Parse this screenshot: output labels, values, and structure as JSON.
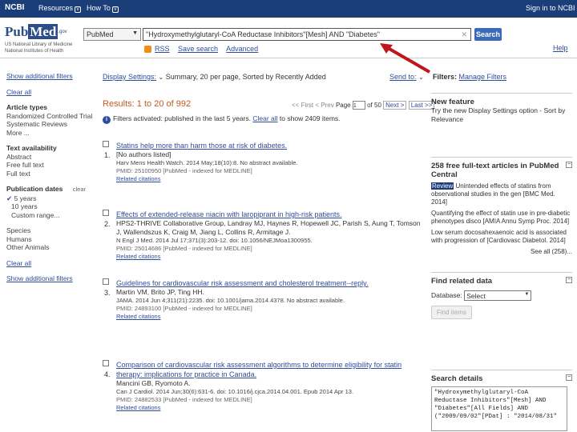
{
  "topbar": {
    "logo": "NCBI",
    "resources": "Resources",
    "howto": "How To",
    "signin": "Sign in to NCBI"
  },
  "header": {
    "logo_pub": "Pub",
    "logo_med": "Med",
    "logo_gov": ".gov",
    "nlm_line1": "US National Library of Medicine",
    "nlm_line2": "National Institutes of Health",
    "db_value": "PubMed",
    "search_value": "\"Hydroxymethylglutaryl-CoA Reductase Inhibitors\"[Mesh] AND \"Diabetes\"",
    "search_button": "Search",
    "rss": "RSS",
    "save_search": "Save search",
    "advanced": "Advanced",
    "help": "Help"
  },
  "left": {
    "show_filters": "Show additional filters",
    "clear_all": "Clear all",
    "article_types": "Article types",
    "at_items": [
      "Randomized Controlled Trial",
      "Systematic Reviews",
      "More ..."
    ],
    "text_avail": "Text availability",
    "ta_items": [
      "Abstract",
      "Free full text",
      "Full text"
    ],
    "pub_dates": "Publication dates",
    "clear": "clear",
    "pd_items": [
      "5 years",
      "10 years",
      "Custom range..."
    ],
    "species": "Species",
    "sp_items": [
      "Humans",
      "Other Animals"
    ],
    "clear_all2": "Clear all",
    "show_filters2": "Show additional filters"
  },
  "main": {
    "display_settings": "Display Settings:",
    "display_value": "Summary, 20 per page, Sorted by Recently Added",
    "send_to": "Send to:",
    "results": "Results: 1 to 20 of 992",
    "pager_first": "<< First",
    "pager_prev": "< Prev",
    "page_label": "Page",
    "page_value": "1",
    "page_of": "of 50",
    "pager_next": "Next >",
    "pager_last": "Last >>",
    "filter_notice": "Filters activated: published in the last 5 years.",
    "filter_clear": "Clear all",
    "filter_show": "to show 2409 items.",
    "results_list": [
      {
        "num": "1.",
        "title": "Statins help more than harm those at risk of diabetes.",
        "authors": "[No authors listed]",
        "cite": "Harv Mens Health Watch. 2014 May;18(10):8. No abstract available.",
        "pmid": "PMID: 25100950 [PubMed - indexed for MEDLINE]",
        "related": "Related citations"
      },
      {
        "num": "2.",
        "title": "Effects of extended-release niacin with laropiprant in high-risk patients.",
        "authors": "HPS2-THRIVE Collaborative Group, Landray MJ, Haynes R, Hopewell JC, Parish S, Aung T, Tomson J, Wallendszus K, Craig M, Jiang L, Collins R, Armitage J.",
        "cite": "N Engl J Med. 2014 Jul 17;371(3):203-12. doi: 10.1056/NEJMoa1300955.",
        "pmid": "PMID: 25014686 [PubMed - indexed for MEDLINE]",
        "related": "Related citations"
      },
      {
        "num": "3.",
        "title": "Guidelines for cardiovascular risk assessment and cholesterol treatment--reply.",
        "authors": "Martin VM, Brito JP, Ting HH.",
        "cite": "JAMA. 2014 Jun 4;311(21):2235. doi: 10.1001/jama.2014.4378. No abstract available.",
        "pmid": "PMID: 24893100 [PubMed - indexed for MEDLINE]",
        "related": "Related citations"
      },
      {
        "num": "4.",
        "title": "Comparison of cardiovascular risk assessment algorithms to determine eligibility for statin therapy: implications for practice in Canada.",
        "authors": "Mancini GB, Ryomoto A.",
        "cite": "Can J Cardiol. 2014 Jun;30(6):631-6. doi: 10.1016/j.cjca.2014.04.001. Epub 2014 Apr 13.",
        "pmid": "PMID: 24882533 [PubMed - indexed for MEDLINE]",
        "related": "Related citations"
      }
    ]
  },
  "right": {
    "filters": "Filters:",
    "manage_filters": "Manage Filters",
    "new_feature_title": "New feature",
    "new_feature_text": "Try the new Display Settings option - Sort by Relevance",
    "free_title": "258 free full-text articles in PubMed Central",
    "free_items": [
      {
        "badge": "Review",
        "text": "Unintended effects of statins from observational studies in the gen",
        "src": "[BMC Med. 2014]"
      },
      {
        "badge": "",
        "text": "Quantifying the effect of statin use in pre-diabetic phenotypes disco",
        "src": "[AMIA Annu Symp Proc. 2014]"
      },
      {
        "badge": "",
        "text": "Low serum docosahexaenoic acid is associated with progression of",
        "src": "[Cardiovasc Diabetol. 2014]"
      }
    ],
    "see_all": "See all (258)...",
    "related_title": "Find related data",
    "database_label": "Database:",
    "database_value": "Select",
    "find_items": "Find items",
    "details_title": "Search details",
    "details_text": "\"Hydroxymethylglutaryl-CoA Reductase Inhibitors\"[Mesh] AND \"Diabetes\"[All Fields] AND (\"2009/09/02\"[PDat] : \"2014/08/31\""
  },
  "colors": {
    "topbar": "#1b3d78",
    "link": "#2f4c9e",
    "results_heading": "#c35a1e",
    "annotation_arrow": "#c0161b"
  }
}
